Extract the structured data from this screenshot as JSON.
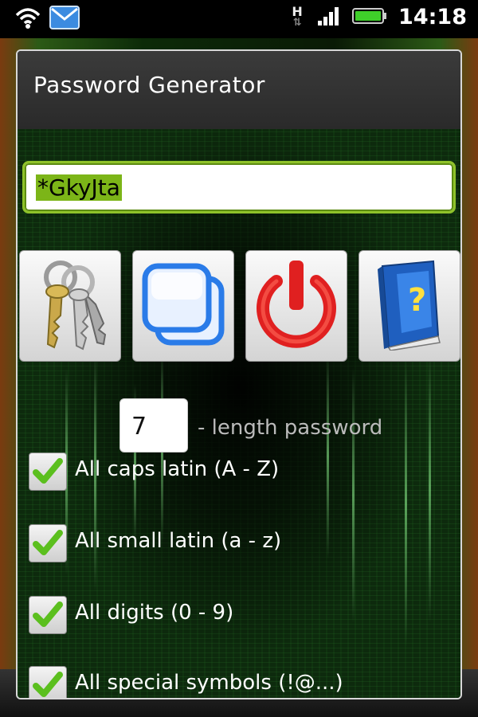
{
  "status_bar": {
    "time": "14:18",
    "network_type": "H",
    "icons": [
      "wifi-icon",
      "mail-icon",
      "data-arrows-icon",
      "signal-icon",
      "battery-icon"
    ]
  },
  "dialog": {
    "title": "Password Generator",
    "password_value": "*GkyJta",
    "buttons": [
      {
        "name": "generate-button",
        "icon": "keys-icon"
      },
      {
        "name": "copy-button",
        "icon": "copy-icon"
      },
      {
        "name": "exit-button",
        "icon": "power-icon"
      },
      {
        "name": "help-button",
        "icon": "help-book-icon"
      }
    ],
    "length": {
      "value": "7",
      "label": "- length password"
    },
    "options": [
      {
        "label": "All caps latin (A - Z)",
        "checked": true
      },
      {
        "label": "All small latin (a - z)",
        "checked": true
      },
      {
        "label": "All digits (0 - 9)",
        "checked": true
      },
      {
        "label": "All special symbols (!@...)",
        "checked": true
      }
    ]
  },
  "colors": {
    "accent_green": "#8fc22a",
    "selection_green": "#7cb518",
    "power_red": "#e02020",
    "copy_blue": "#2a7be8"
  }
}
